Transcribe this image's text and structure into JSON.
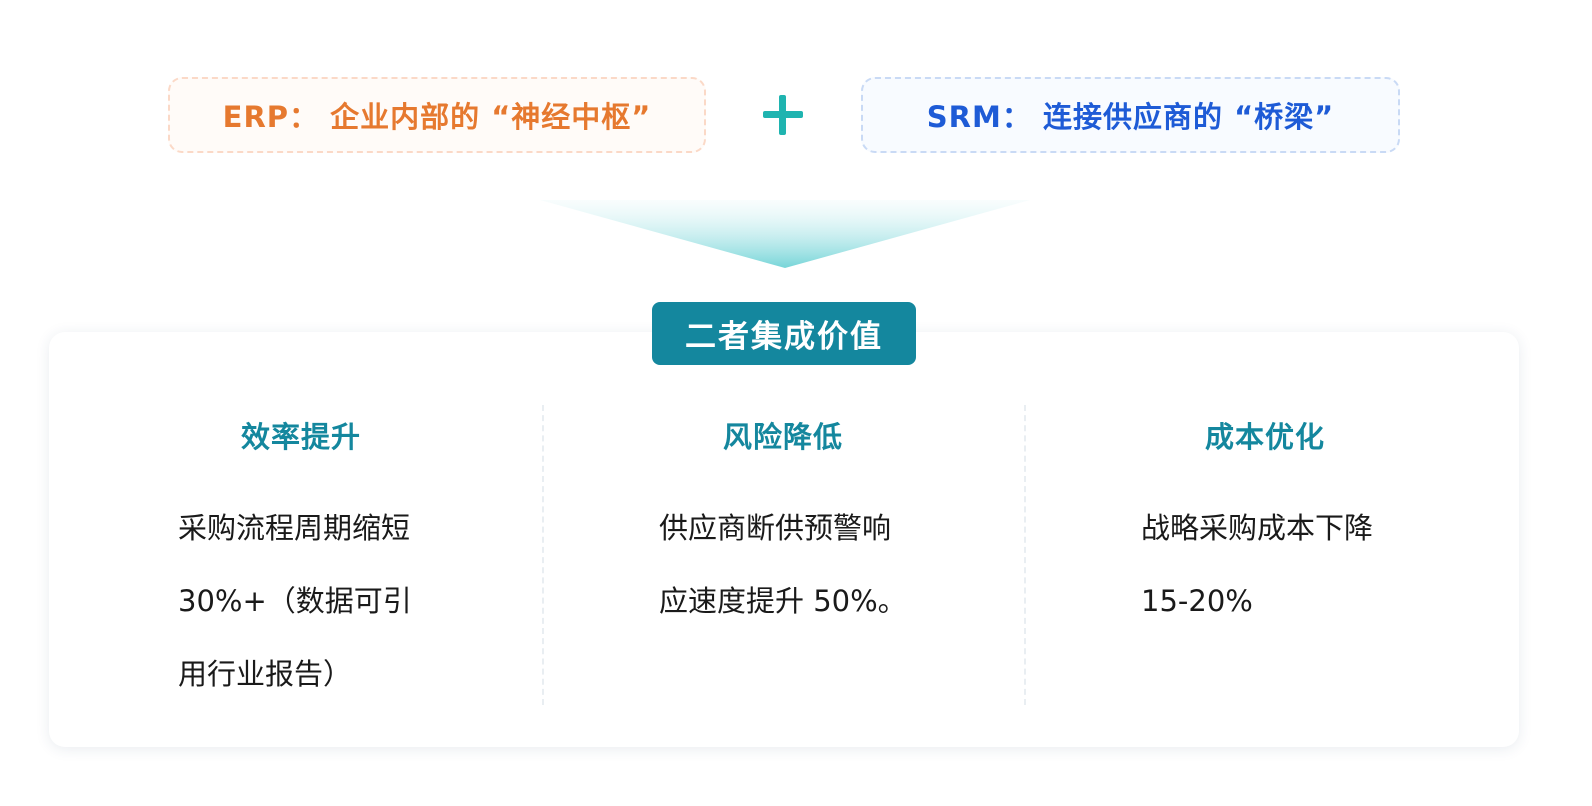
{
  "erp": {
    "label": "ERP： 企业内部的 “神经中枢”"
  },
  "srm": {
    "label": "SRM： 连接供应商的 “桥梁”"
  },
  "plus_icon": "plus-icon",
  "colors": {
    "erp": "#e6792f",
    "srm": "#1e5bd6",
    "plus": "#1fb4b0",
    "accent": "#14879e",
    "text": "#1a1a1a"
  },
  "integration": {
    "title": "二者集成价值",
    "columns": [
      {
        "title": "效率提升",
        "lines": [
          "采购流程周期缩短",
          "30%+（数据可引",
          "用行业报告）"
        ]
      },
      {
        "title": "风险降低",
        "lines": [
          "供应商断供预警响",
          "应速度提升 50%。"
        ]
      },
      {
        "title": "成本优化",
        "lines": [
          "战略采购成本下降",
          "15-20%"
        ]
      }
    ]
  }
}
